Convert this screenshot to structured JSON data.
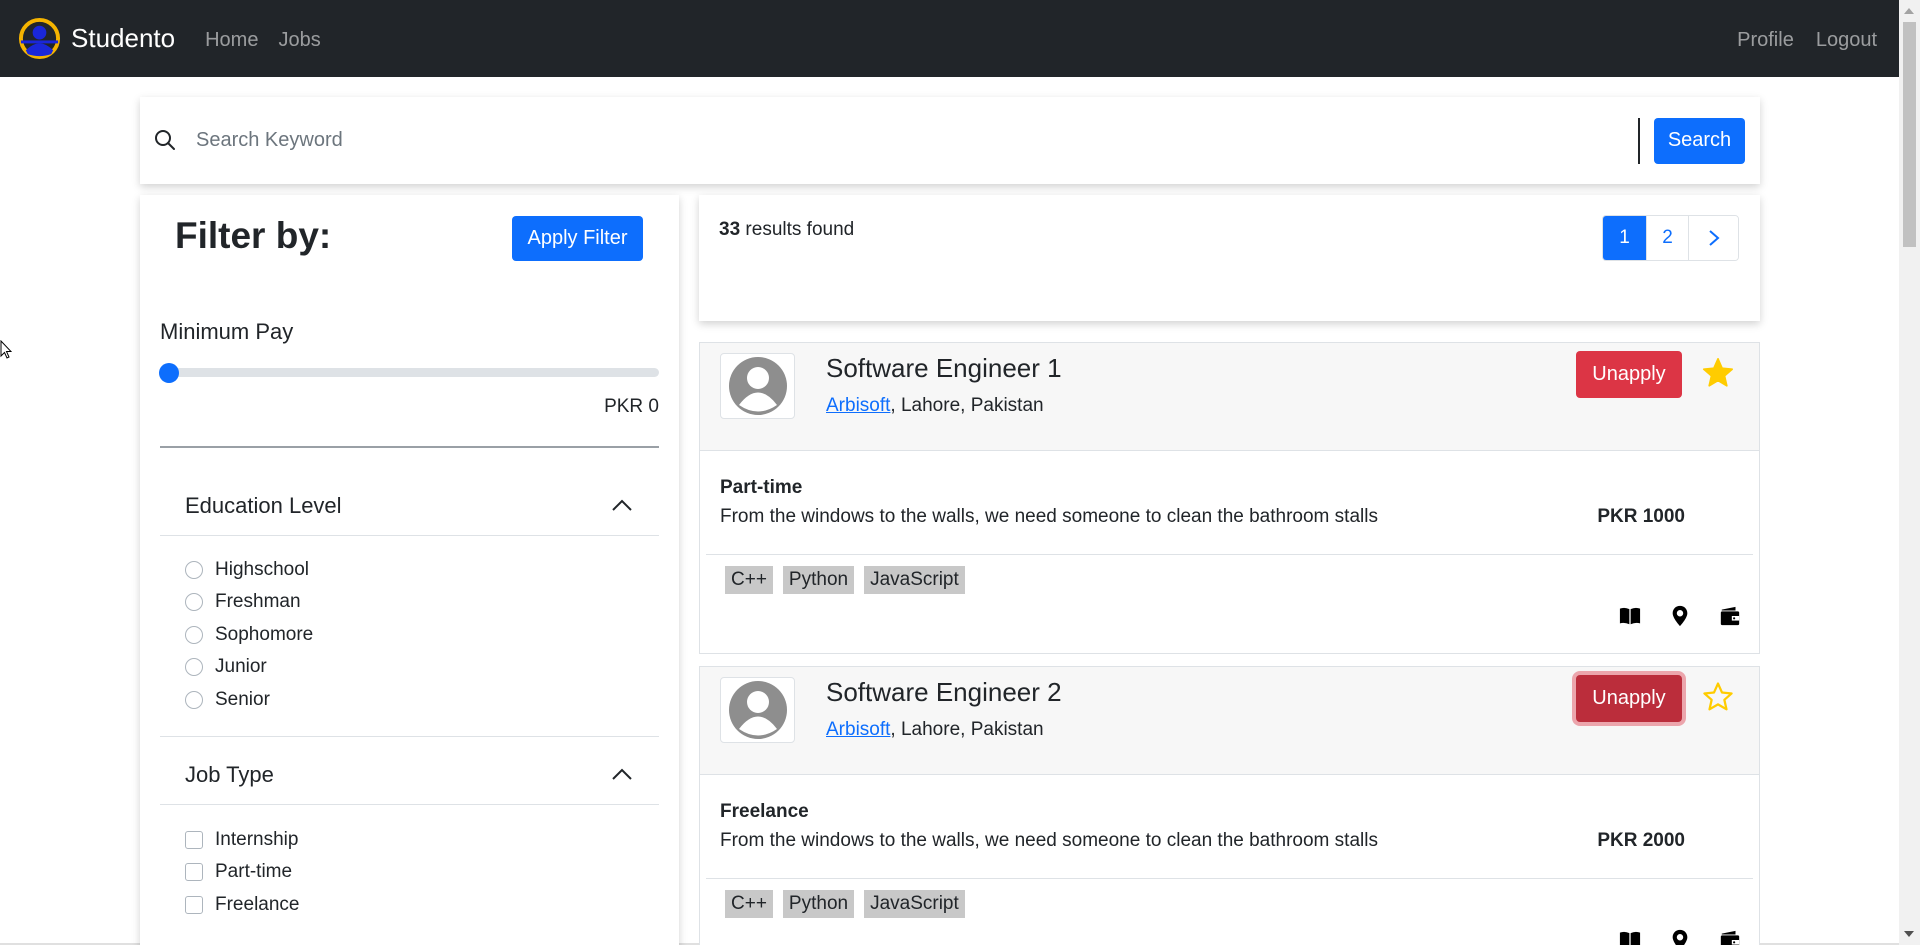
{
  "navbar": {
    "brand": "Studento",
    "links_left": [
      "Home",
      "Jobs"
    ],
    "links_right": [
      "Profile",
      "Logout"
    ],
    "colors": {
      "background": "#212529",
      "logo_ring": "#f5b400",
      "logo_person": "#1a27d9"
    }
  },
  "search": {
    "placeholder": "Search Keyword",
    "button": "Search",
    "icon": "search-icon"
  },
  "filter": {
    "title": "Filter by:",
    "apply_button": "Apply Filter",
    "min_pay": {
      "label": "Minimum Pay",
      "value_text": "PKR 0",
      "slider_fraction": 0
    },
    "education": {
      "title": "Education Level",
      "expanded": true,
      "options": [
        "Highschool",
        "Freshman",
        "Sophomore",
        "Junior",
        "Senior"
      ]
    },
    "job_type": {
      "title": "Job Type",
      "expanded": true,
      "options": [
        "Internship",
        "Part-time",
        "Freelance"
      ]
    }
  },
  "results": {
    "count": "33",
    "suffix": "results found",
    "pagination": {
      "pages": [
        "1",
        "2"
      ],
      "active": "1",
      "next": "next-icon"
    }
  },
  "jobs": [
    {
      "title": "Software Engineer 1",
      "company": "Arbisoft",
      "location": ", Lahore, Pakistan",
      "action": "Unapply",
      "starred": true,
      "type": "Part-time",
      "description": "From the windows to the walls, we need someone to clean the bathroom stalls",
      "pay": "PKR 1000",
      "tags": [
        "C++",
        "Python",
        "JavaScript"
      ],
      "icons": [
        "book-icon",
        "location-pin-icon",
        "wallet-icon"
      ]
    },
    {
      "title": "Software Engineer 2",
      "company": "Arbisoft",
      "location": ", Lahore, Pakistan",
      "action": "Unapply",
      "starred": false,
      "type": "Freelance",
      "description": "From the windows to the walls, we need someone to clean the bathroom stalls",
      "pay": "PKR 2000",
      "tags": [
        "C++",
        "Python",
        "JavaScript"
      ],
      "icons": [
        "book-icon",
        "location-pin-icon",
        "wallet-icon"
      ]
    }
  ],
  "colors": {
    "primary": "#0d6efd",
    "danger": "#dc3545",
    "star": "#ffcc00",
    "tag_bg": "#c8c8c8"
  }
}
